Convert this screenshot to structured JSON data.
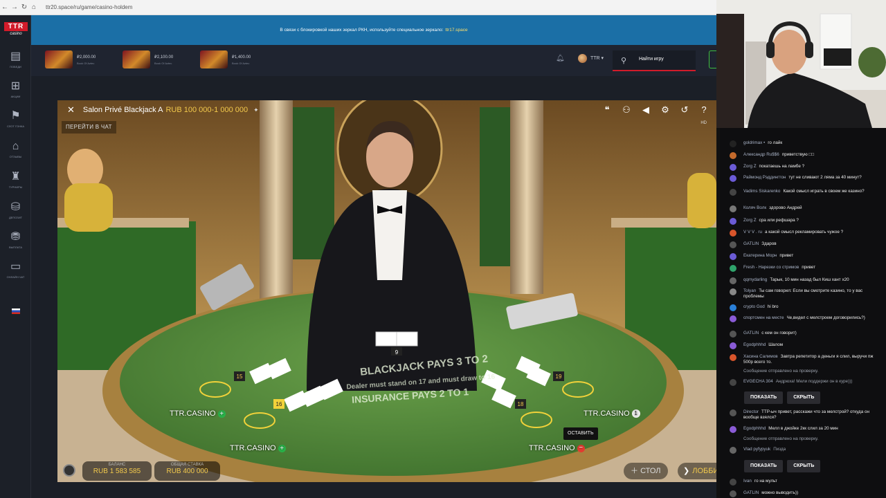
{
  "browser": {
    "url": "ttr20.space/ru/game/casino-holdem"
  },
  "site": {
    "logo_top": "TTR",
    "logo_bottom": "casino",
    "sidebar": [
      {
        "label": "ПОБЕДИ",
        "icon": "gift-box-icon"
      },
      {
        "label": "АКЦИИ",
        "icon": "present-icon"
      },
      {
        "label": "СЛОТ ГОНКА",
        "icon": "race-flag-icon"
      },
      {
        "label": "ОТЗЫВЫ",
        "icon": "reviews-icon"
      },
      {
        "label": "ТУРНИРЫ",
        "icon": "tournament-icon"
      },
      {
        "label": "ДЕПОЗИТ",
        "icon": "deposit-icon"
      },
      {
        "label": "ВЫПЛАТА",
        "icon": "withdraw-icon"
      },
      {
        "label": "ОНЛАЙН ЧАТ",
        "icon": "chat-icon"
      }
    ],
    "notice": "В связи с блокировкой наших зеркал РКН, используйте специальное зеркало:",
    "notice_mirror": "ttr17.space",
    "wins": [
      {
        "amount": "₽2,000.00",
        "game": "Book Of Aztec"
      },
      {
        "amount": "₽2,100.00",
        "game": "Book Of Aztec"
      },
      {
        "amount": "₽1,400.00",
        "game": "Book Of Aztec"
      }
    ],
    "username": "TTR",
    "search_placeholder": "Найти игру"
  },
  "game": {
    "title": "Salon Privé Blackjack A",
    "limits": "RUB 100 000-1 000 000",
    "chat_button": "ПЕРЕЙТИ В ЧАТ",
    "quality": "HD",
    "table_text_1": "BLACKJACK PAYS 3 TO 2",
    "table_text_2": "Dealer must stand on 17 and must draw to 16",
    "table_text_3": "INSURANCE PAYS 2 TO 1",
    "dealer_total": "9",
    "hand_totals": [
      "15",
      "16",
      "19",
      "18"
    ],
    "seat_labels": [
      "TTR.CASINO",
      "TTR.CASINO",
      "TTR.CASINO",
      "TTR.CASINO"
    ],
    "seat_badge": "1",
    "leave_tooltip": "ОСТАВИТЬ",
    "balance_label": "БАЛАНС",
    "balance_value": "RUB 1 583 585",
    "total_bet_label": "ОБЩАЯ СТАВКА",
    "total_bet_value": "RUB 400 000",
    "table_button": "СТОЛ",
    "lobby_button": "ЛОББИ",
    "colors": {
      "felt": "#4f8a3a",
      "gold": "#f2c94c",
      "accent": "#d21b2a"
    }
  },
  "chat": {
    "messages": [
      {
        "user": "goldrimax •",
        "text": "го лайк",
        "color": "#222"
      },
      {
        "user": "Александр Ru$$6",
        "text": "приветствую □□",
        "color": "#c46a2c"
      },
      {
        "user": "Zorg Z",
        "text": "покатаешь на ламбе ?",
        "color": "#6b5bd6"
      },
      {
        "user": "Раймонд Рэддингтон",
        "text": "тут не сливают 2 ляма за 40 минут?",
        "color": "#6b5bd6"
      },
      {
        "user": "Vadims Siskarenko",
        "text": "Какой смысл играть в своем же казино?",
        "color": "#444"
      },
      {
        "user": "Коляч Волк",
        "text": "здорово Андрей",
        "color": "#777"
      },
      {
        "user": "Zorg Z",
        "text": "сра или рефшара ?",
        "color": "#6b5bd6"
      },
      {
        "user": "V V V . ru",
        "text": "а какой смысл рекламировать чужое ?",
        "color": "#d8552b"
      },
      {
        "user": "GATLIN",
        "text": "Здаров",
        "color": "#555"
      },
      {
        "user": "Екатерина Морн",
        "text": "привет",
        "color": "#6b5bd6"
      },
      {
        "user": "Fresh - Нарезки со стримов",
        "text": "привет",
        "color": "#2fa36b"
      },
      {
        "user": "qqmydarling",
        "text": "Тарык, 10 мин назад был Киш хант х20",
        "color": "#666"
      },
      {
        "user": "Tolyan",
        "text": "Ты сам говорил: Если вы смотрите казино, то у вас проблемы",
        "color": "#888"
      },
      {
        "user": "crypto God",
        "text": "hi bro",
        "color": "#2a7fd8"
      },
      {
        "user": "спортсмен на месте",
        "text": "Че,видел с мелстроем договорились?)",
        "color": "#8a5bd6"
      },
      {
        "user": "GATLIN",
        "text": "с кем он говорит)",
        "color": "#555"
      },
      {
        "user": "Egodphhhd",
        "text": "Шалом",
        "color": "#8a5bd6"
      },
      {
        "user": "Хасина Салимов",
        "text": "Завтра репетитор а деньги я слил, выручи пж 500р всего то.",
        "color": "#d8552b"
      }
    ],
    "system_1": "Сообщение отправлено на проверку.",
    "held_1": {
      "user": "EVGECHA 304",
      "text": "Андрюха! Мели поддержи он в куре)))"
    },
    "show": "ПОКАЗАТЬ",
    "hide": "СКРЫТЬ",
    "messages_2": [
      {
        "user": "Director",
        "text": "ТТР-ыч привет, расскажи что за мелстрой? откуда он вообще взялся?",
        "color": "#555"
      },
      {
        "user": "Egodphhhd",
        "text": "Мелл в джойке 2кк слил за 20 мин",
        "color": "#8a5bd6"
      }
    ],
    "system_2": "Сообщение отправлено на проверку.",
    "held_2": {
      "user": "Vlad pyfypyuk",
      "text": "Пизда"
    },
    "messages_3": [
      {
        "user": "Ivan",
        "text": "го на мульт",
        "color": "#444"
      },
      {
        "user": "GATLIN",
        "text": "можно выводить))",
        "color": "#555"
      }
    ]
  }
}
